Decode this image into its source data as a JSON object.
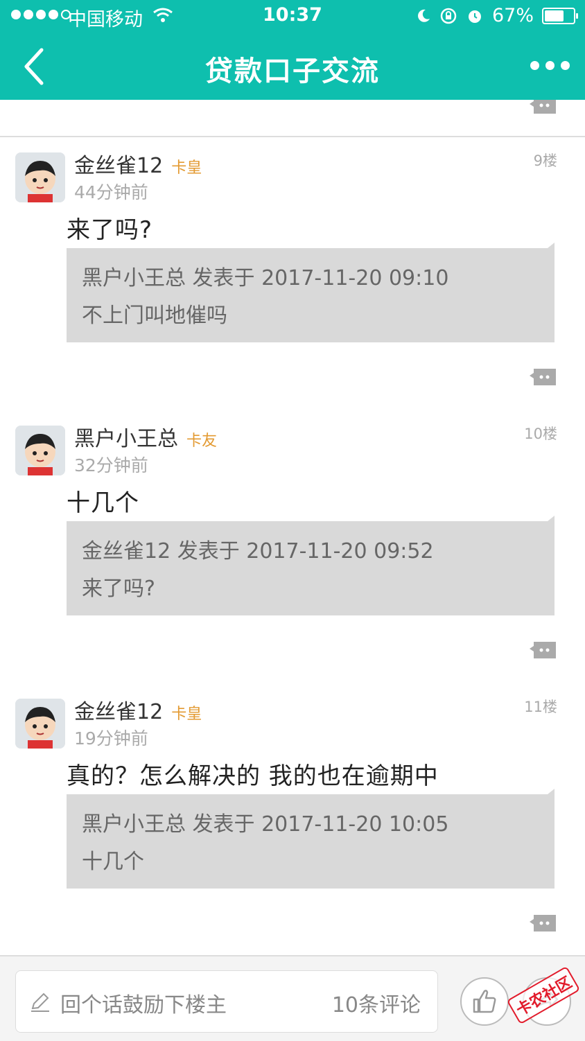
{
  "status_bar": {
    "carrier": "中国移动",
    "time": "10:37",
    "battery": "67%",
    "battery_level": 0.67
  },
  "nav": {
    "title": "贷款口子交流"
  },
  "posts": [
    {
      "username": "金丝雀12",
      "level": "卡皇",
      "time": "44分钟前",
      "floor": "9楼",
      "text": "来了吗?",
      "quote_header": "黑户小王总 发表于 2017-11-20 09:10",
      "quote_text": "不上门叫地催吗"
    },
    {
      "username": "黑户小王总",
      "level": "卡友",
      "time": "32分钟前",
      "floor": "10楼",
      "text": "十几个",
      "quote_header": "金丝雀12 发表于 2017-11-20 09:52",
      "quote_text": "来了吗?"
    },
    {
      "username": "金丝雀12",
      "level": "卡皇",
      "time": "19分钟前",
      "floor": "11楼",
      "text": "真的？怎么解决的 我的也在逾期中",
      "quote_header": "黑户小王总 发表于 2017-11-20 10:05",
      "quote_text": "十几个"
    }
  ],
  "bottom_bar": {
    "reply_placeholder": "回个话鼓励下楼主",
    "comment_count": "10条评论",
    "watermark": "卡农社区"
  },
  "colors": {
    "brand": "#0ebfae",
    "level": "#e39a32"
  }
}
